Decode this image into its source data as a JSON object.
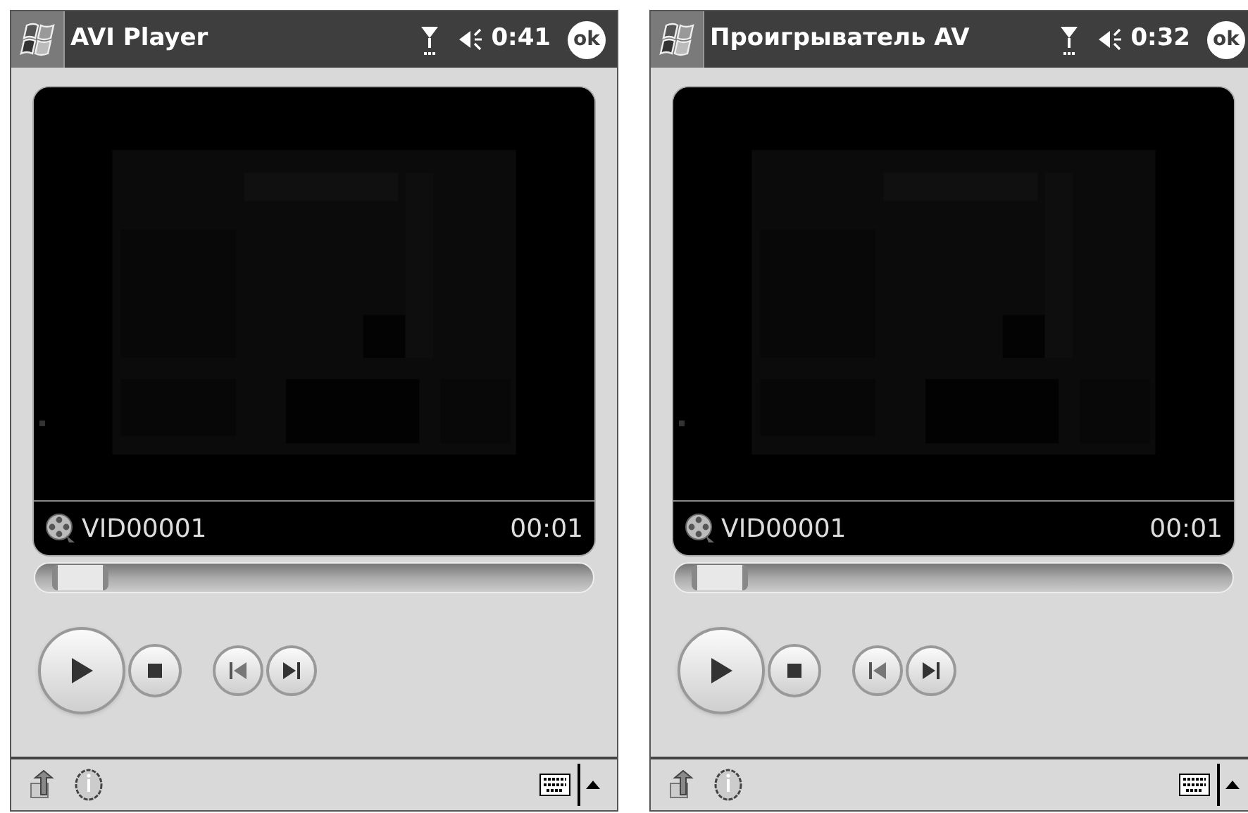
{
  "screens": [
    {
      "title": "AVI Player",
      "time": "0:41",
      "ok": "ok",
      "filename": "VID00001",
      "elapsed": "00:01",
      "level": 0.03
    },
    {
      "title": "Проигрыватель AV",
      "time": "0:32",
      "ok": "ok",
      "filename": "VID00001",
      "elapsed": "00:01",
      "level": 0.03
    }
  ]
}
